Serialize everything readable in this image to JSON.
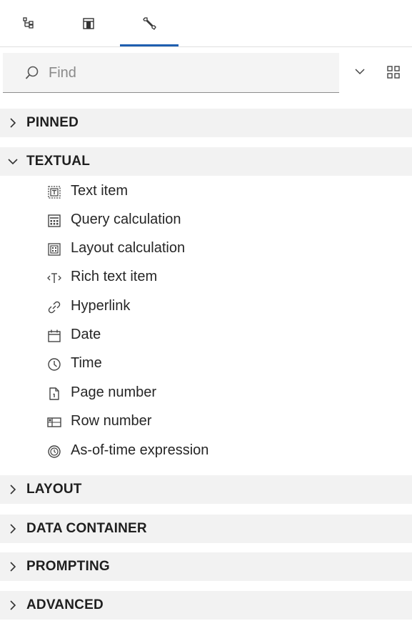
{
  "tabs": [
    {
      "icon": "data-tree-icon"
    },
    {
      "icon": "panel-layout-icon"
    },
    {
      "icon": "toolbox-wrench-icon",
      "active": true
    }
  ],
  "search": {
    "placeholder": "Find",
    "value": "",
    "dropdown_icon": "chevron-down-icon",
    "view_icon": "grid-view-icon"
  },
  "sections": {
    "pinned": {
      "label": "PINNED",
      "expanded": false
    },
    "textual": {
      "label": "TEXTUAL",
      "expanded": true,
      "items": [
        {
          "label": "Text item",
          "icon": "text-item-icon"
        },
        {
          "label": "Query calculation",
          "icon": "calculator-icon"
        },
        {
          "label": "Layout calculation",
          "icon": "layout-calculation-icon"
        },
        {
          "label": "Rich text item",
          "icon": "rich-text-icon"
        },
        {
          "label": "Hyperlink",
          "icon": "link-icon"
        },
        {
          "label": "Date",
          "icon": "calendar-icon"
        },
        {
          "label": "Time",
          "icon": "clock-icon"
        },
        {
          "label": "Page number",
          "icon": "page-number-icon"
        },
        {
          "label": "Row number",
          "icon": "row-number-icon"
        },
        {
          "label": "As-of-time expression",
          "icon": "as-of-time-icon"
        }
      ]
    },
    "layout": {
      "label": "LAYOUT",
      "expanded": false
    },
    "data_container": {
      "label": "DATA CONTAINER",
      "expanded": false
    },
    "prompting": {
      "label": "PROMPTING",
      "expanded": false
    },
    "advanced": {
      "label": "ADVANCED",
      "expanded": false
    }
  },
  "colors": {
    "accent": "#1f5fb0",
    "section_bg": "#f2f2f2",
    "search_bg": "#f4f4f4"
  }
}
